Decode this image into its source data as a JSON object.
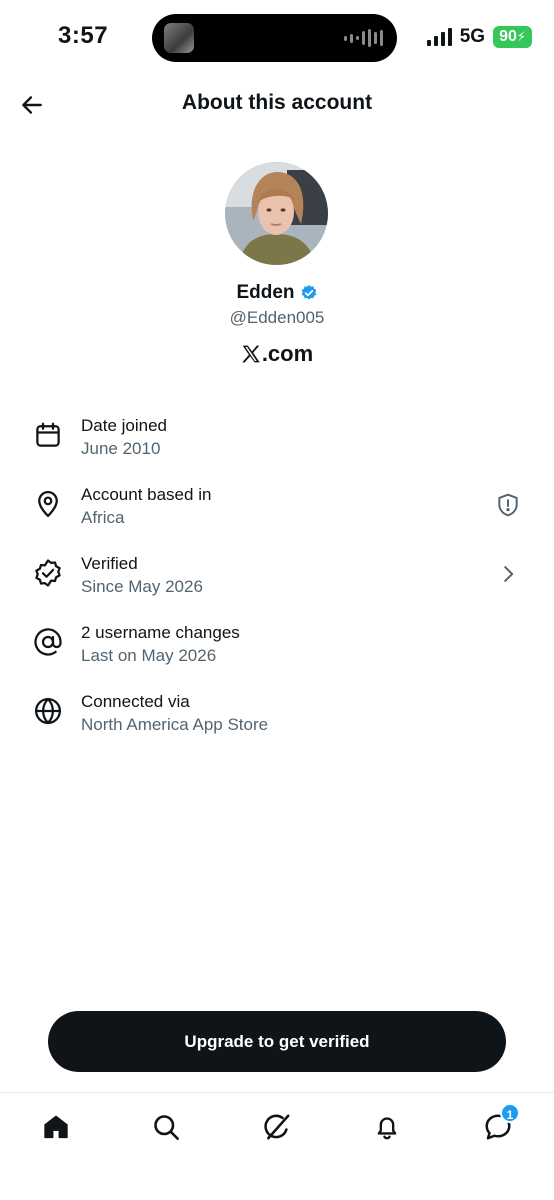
{
  "status_bar": {
    "time": "3:57",
    "network": "5G",
    "battery": "90"
  },
  "header": {
    "title": "About this account",
    "back_icon": "arrow-left-icon"
  },
  "profile": {
    "display_name": "Edden",
    "handle": "@Edden005",
    "verified_badge_color": "#1d9bf0",
    "site_logo": "X",
    "site_suffix": ".com"
  },
  "info_items": [
    {
      "icon": "calendar-icon",
      "label": "Date joined",
      "value": "June 2010"
    },
    {
      "icon": "location-pin-icon",
      "label": "Account based in",
      "value": "Africa",
      "trailing_icon": "shield-alert-icon"
    },
    {
      "icon": "verified-badge-icon",
      "label": "Verified",
      "value": "Since May 2026",
      "trailing_icon": "chevron-right-icon"
    },
    {
      "icon": "at-sign-icon",
      "label": "2 username changes",
      "value": "Last on May 2026"
    },
    {
      "icon": "globe-icon",
      "label": "Connected via",
      "value": "North America App Store"
    }
  ],
  "cta": {
    "label": "Upgrade to get verified"
  },
  "bottom_nav": {
    "items": [
      "home-icon",
      "search-icon",
      "grok-icon",
      "bell-icon",
      "messages-icon"
    ],
    "messages_badge": "1"
  },
  "colors": {
    "text_primary": "#0f1419",
    "text_secondary": "#536471",
    "accent": "#1d9bf0",
    "battery": "#34c759"
  }
}
